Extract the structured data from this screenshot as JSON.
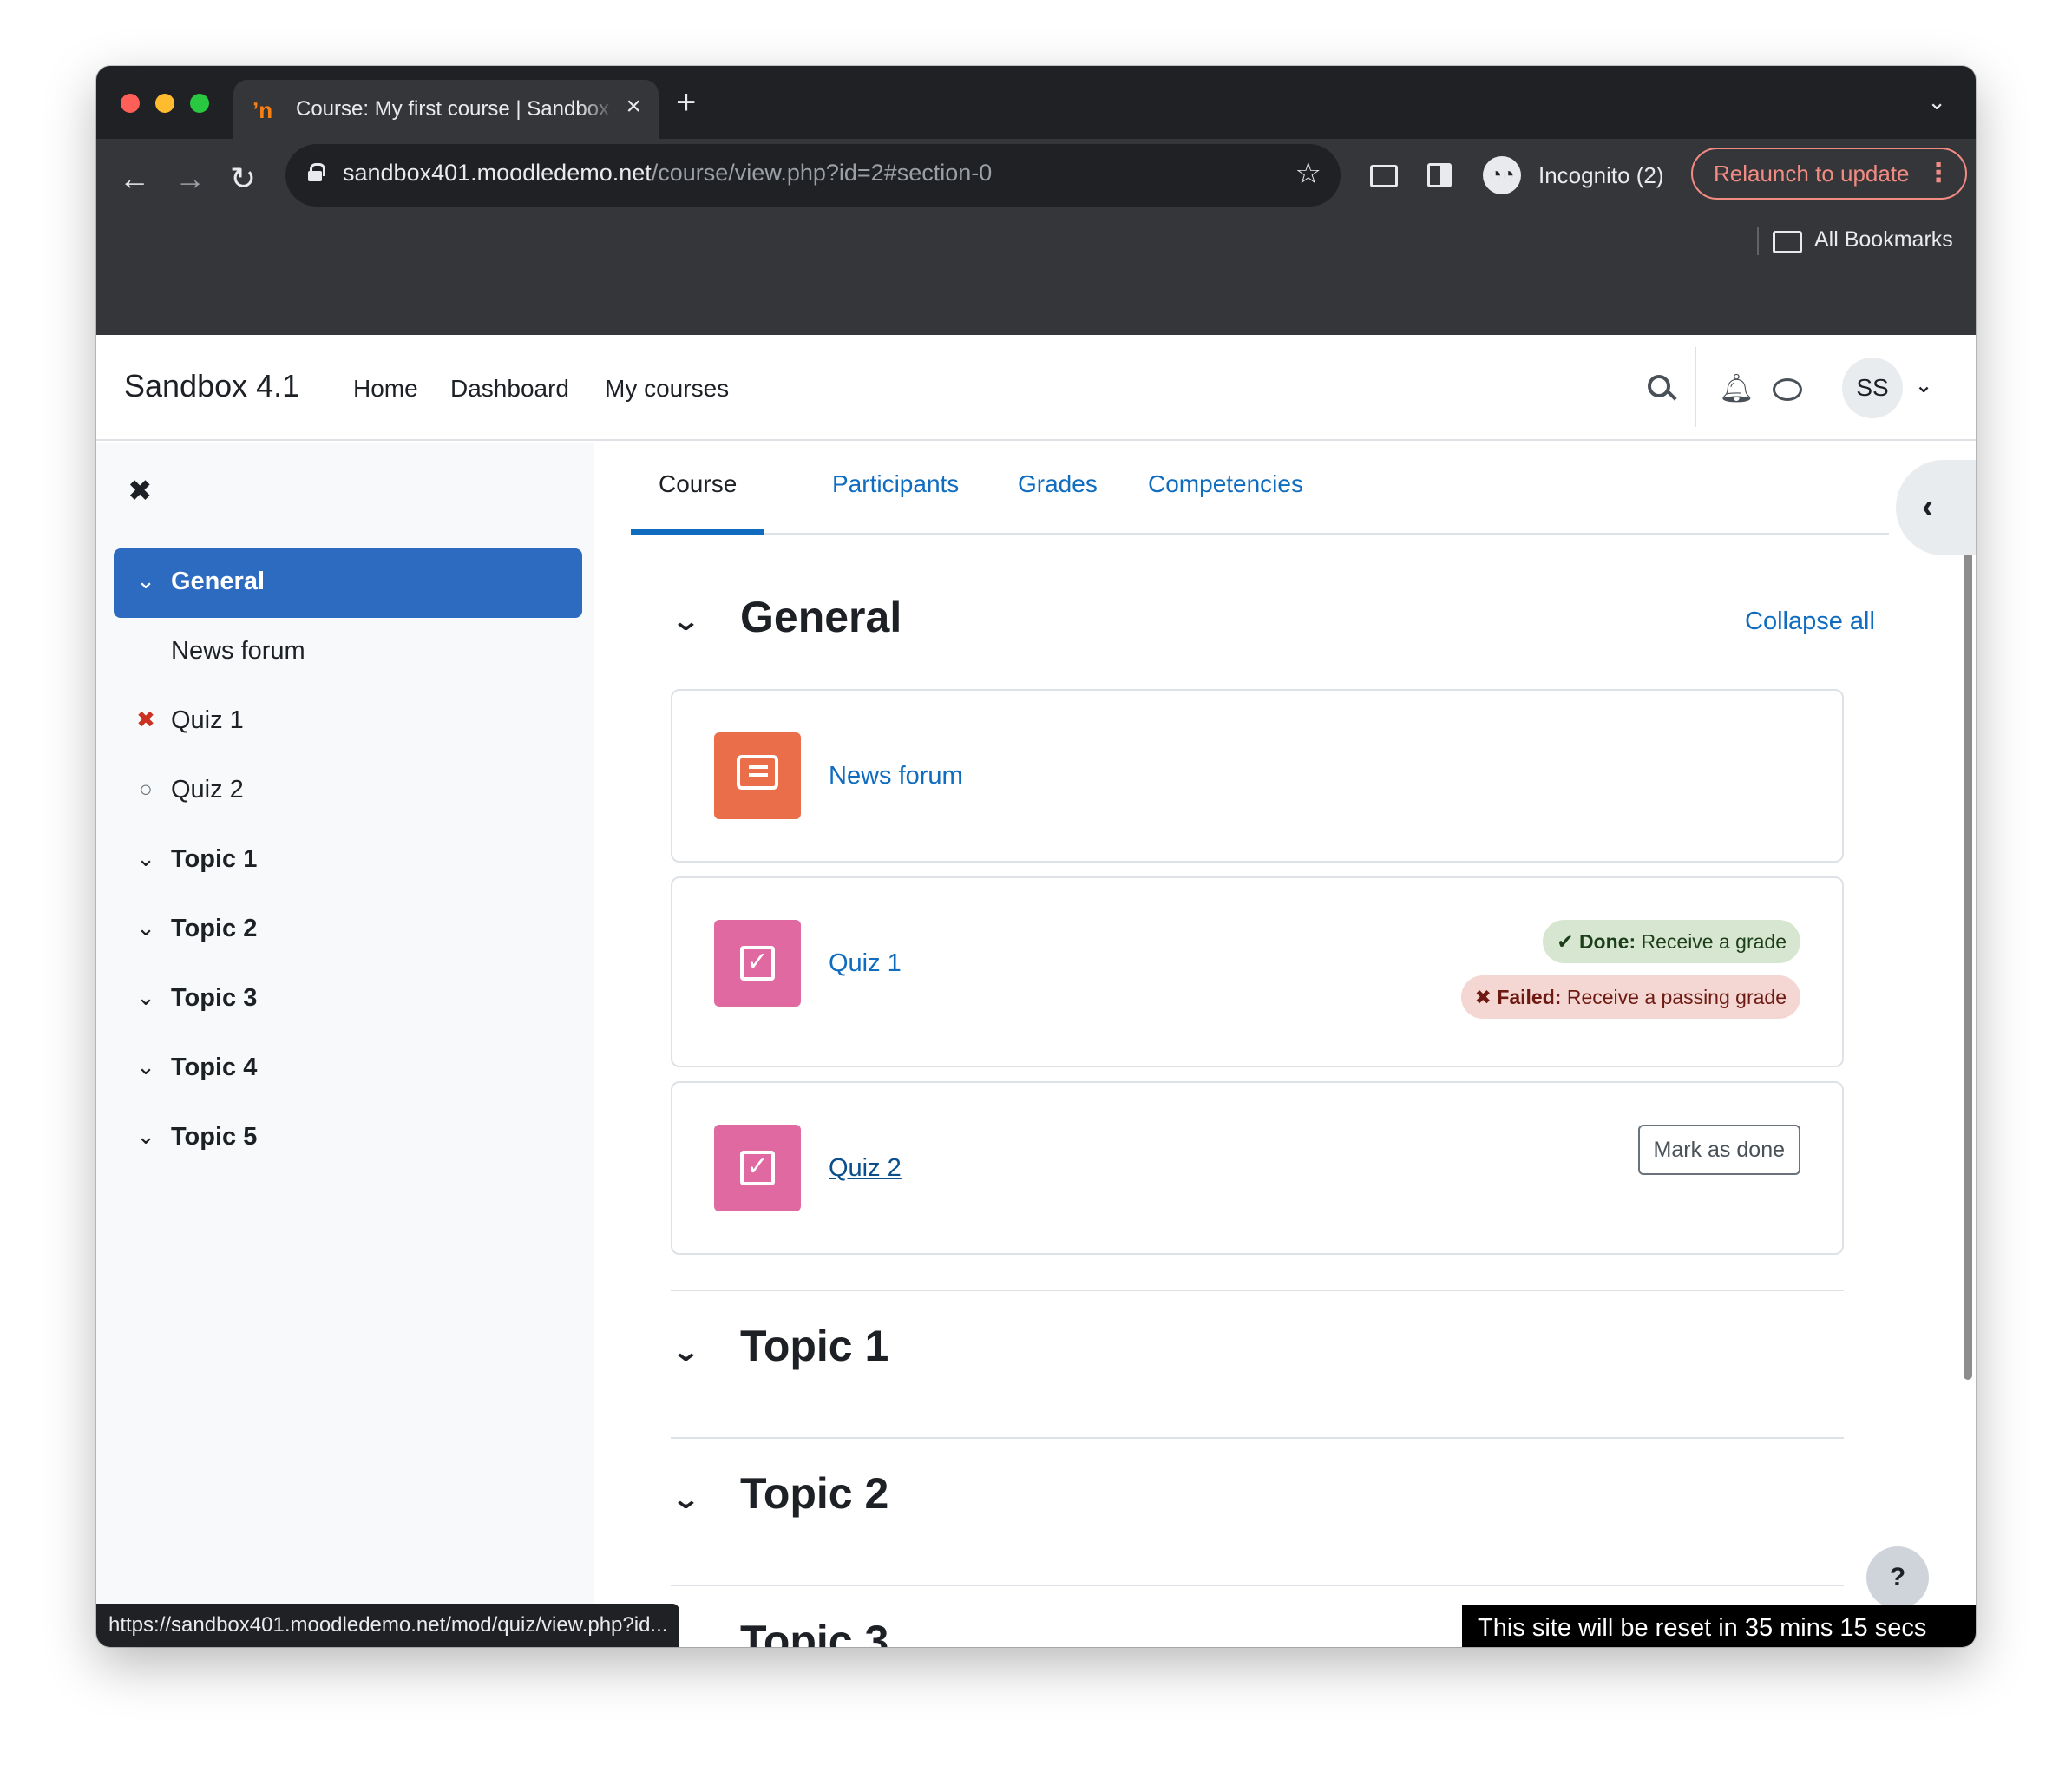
{
  "browser": {
    "tab_title": "Course: My first course | Sandbox 4.1",
    "tab_favicon": "moodle-icon",
    "url_host": "sandbox401.moodledemo.net",
    "url_path": "/course/view.php?id=2#section-0",
    "incognito_label": "Incognito (2)",
    "relaunch_label": "Relaunch to update",
    "bookmarks_label": "All Bookmarks",
    "status_url": "https://sandbox401.moodledemo.net/mod/quiz/view.php?id..."
  },
  "navbar": {
    "brand": "Sandbox 4.1",
    "links": [
      "Home",
      "Dashboard",
      "My courses"
    ],
    "avatar_initials": "SS"
  },
  "course_index": {
    "items": [
      {
        "label": "General",
        "icon": "chevron-down-icon",
        "active": true
      },
      {
        "label": "News forum",
        "icon": ""
      },
      {
        "label": "Quiz 1",
        "icon": "failed-x-icon"
      },
      {
        "label": "Quiz 2",
        "icon": "incomplete-circle-icon"
      },
      {
        "label": "Topic 1",
        "icon": "chevron-down-icon"
      },
      {
        "label": "Topic 2",
        "icon": "chevron-down-icon"
      },
      {
        "label": "Topic 3",
        "icon": "chevron-down-icon"
      },
      {
        "label": "Topic 4",
        "icon": "chevron-down-icon"
      },
      {
        "label": "Topic 5",
        "icon": "chevron-down-icon"
      }
    ]
  },
  "tabs": [
    "Course",
    "Participants",
    "Grades",
    "Competencies"
  ],
  "main": {
    "section_title": "General",
    "collapse_all": "Collapse all",
    "activities": [
      {
        "name": "News forum",
        "type": "forum"
      },
      {
        "name": "Quiz 1",
        "type": "quiz",
        "done_label": "Done:",
        "done_text": "Receive a grade",
        "failed_label": "Failed:",
        "failed_text": "Receive a passing grade"
      },
      {
        "name": "Quiz 2",
        "type": "quiz",
        "button": "Mark as done"
      }
    ],
    "topics": [
      "Topic 1",
      "Topic 2",
      "Topic 3"
    ]
  },
  "footer": {
    "reset_notice": "This site will be reset in 35 mins 15 secs",
    "help_label": "?"
  },
  "colors": {
    "primary": "#0f6cbf",
    "active_index": "#2d6bc1",
    "forum_icon": "#eb6e4b",
    "quiz_icon": "#e069a2",
    "done_badge": "#d7e6d0",
    "failed_badge": "#f4d6d2"
  }
}
